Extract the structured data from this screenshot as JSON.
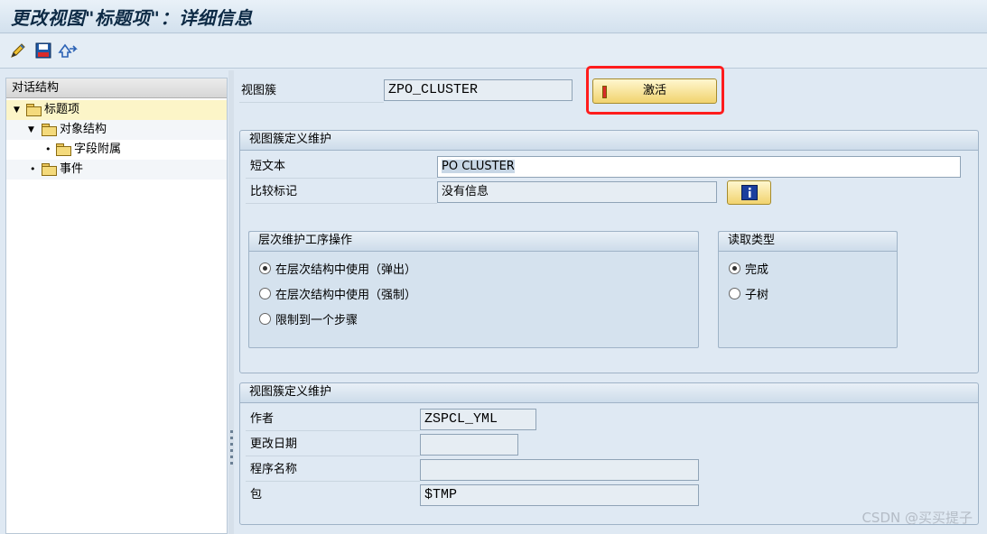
{
  "window": {
    "title": "更改视图\"标题项\"：详细信息"
  },
  "toolbar": {
    "icons": [
      "pencil-icon",
      "save-icon",
      "transport-icon"
    ]
  },
  "tree": {
    "header": "对话结构",
    "items": [
      {
        "label": "标题项",
        "expanded": true,
        "selected": true
      },
      {
        "label": "对象结构",
        "expanded": true
      },
      {
        "label": "字段附属"
      },
      {
        "label": "事件"
      }
    ]
  },
  "top": {
    "view_cluster_label": "视图簇",
    "view_cluster_value": "ZPO_CLUSTER",
    "activate_label": "激活"
  },
  "def_group": {
    "title": "视图簇定义维护",
    "short_text_label": "短文本",
    "short_text_value": "PO CLUSTER",
    "compare_label": "比较标记",
    "compare_value": "没有信息"
  },
  "hier_group": {
    "title": "层次维护工序操作",
    "options": [
      {
        "label": "在层次结构中使用（弹出）",
        "selected": true
      },
      {
        "label": "在层次结构中使用（强制）",
        "selected": false
      },
      {
        "label": "限制到一个步骤",
        "selected": false
      }
    ]
  },
  "read_group": {
    "title": "读取类型",
    "options": [
      {
        "label": "完成",
        "selected": true
      },
      {
        "label": "子树",
        "selected": false
      }
    ]
  },
  "meta_group": {
    "title": "视图簇定义维护",
    "author_label": "作者",
    "author_value": "ZSPCL_YML",
    "changed_label": "更改日期",
    "changed_value": "",
    "program_label": "程序名称",
    "program_value": "",
    "package_label": "包",
    "package_value": "$TMP"
  },
  "watermark": "CSDN @买买提子",
  "colors": {
    "highlight": "#ff1c1c",
    "button": "#f1d36e",
    "selection": "#fcf5c8"
  }
}
